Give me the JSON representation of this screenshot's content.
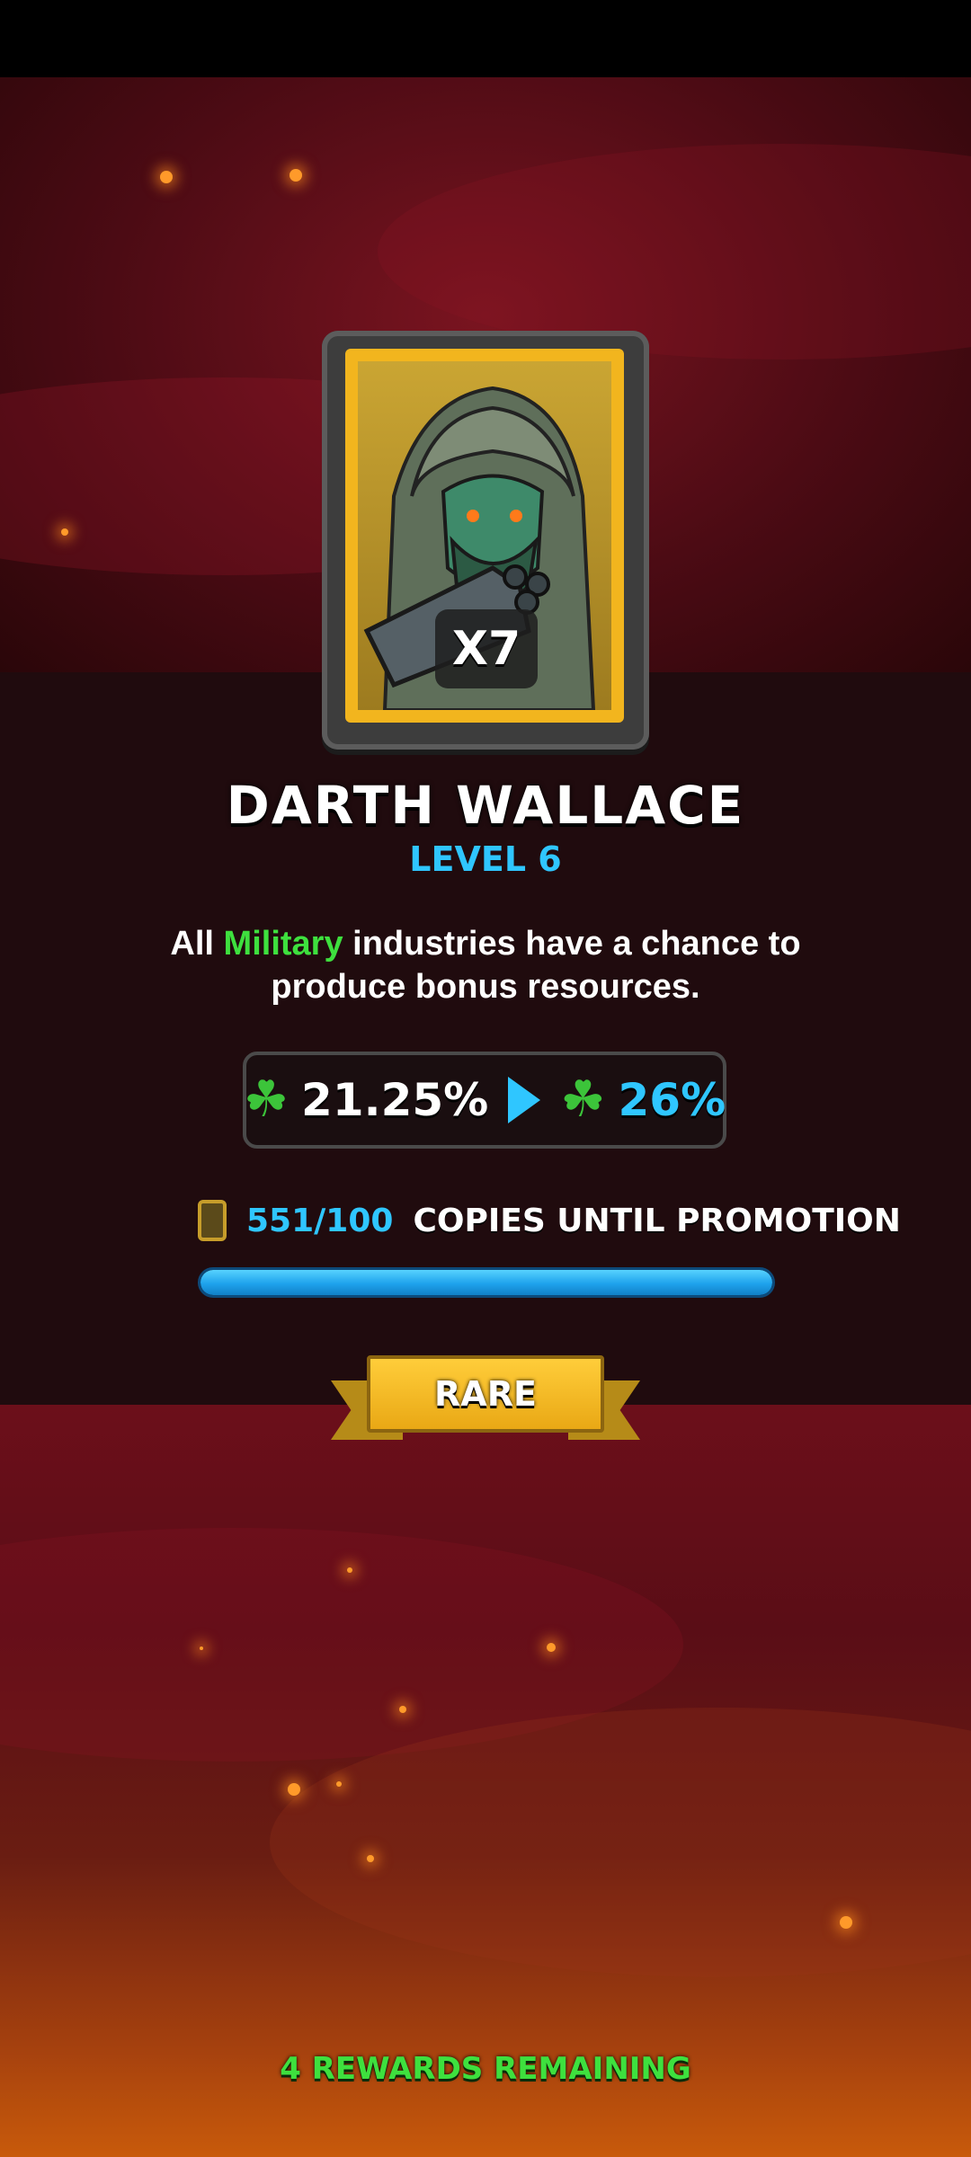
{
  "card": {
    "quantity": "X7",
    "name": "DARTH WALLACE",
    "level": "LEVEL 6"
  },
  "description": {
    "prefix": "All ",
    "highlight": "Military",
    "suffix": " industries have a chance to produce bonus resources."
  },
  "stats": {
    "current": "21.25%",
    "next": "26%"
  },
  "promotion": {
    "count": "551/100",
    "label": "COPIES UNTIL PROMOTION",
    "progress_fraction": 1.0
  },
  "rarity": "RARE",
  "footer": "4 REWARDS REMAINING",
  "colors": {
    "accent_blue": "#2fc6ff",
    "highlight_green": "#3ee03e",
    "rarity_gold": "#f2b51e"
  },
  "icons": {
    "stat": "clover-icon",
    "arrow": "play-arrow-icon",
    "copies": "card-copy-icon"
  }
}
